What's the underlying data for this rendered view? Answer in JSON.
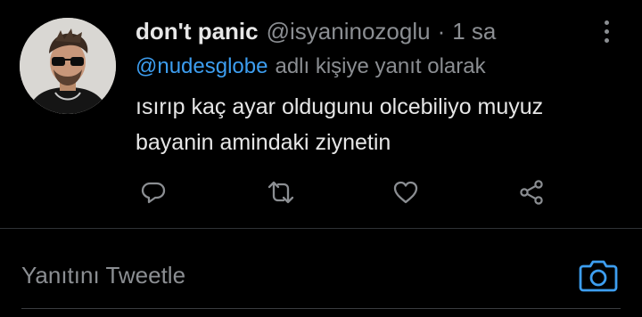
{
  "tweet": {
    "display_name": "don't panic",
    "handle": "@isyaninozoglu",
    "separator": "·",
    "time": "1 sa",
    "reply_to": {
      "mention": "@nudesglobe",
      "suffix": "adlı kişiye yanıt olarak"
    },
    "body_lines": [
      "ısırıp kaç ayar oldugunu olcebiliyo muyuz",
      "bayanin amindaki ziynetin"
    ],
    "actions": [
      "reply-icon",
      "retweet-icon",
      "like-icon",
      "share-icon"
    ]
  },
  "compose": {
    "placeholder": "Yanıtını Tweetle",
    "camera_icon": "camera-icon"
  },
  "colors": {
    "background": "#000000",
    "text": "#e6e6e6",
    "muted": "#8b8e92",
    "accent": "#3d9ef0",
    "divider": "#2f3336"
  }
}
